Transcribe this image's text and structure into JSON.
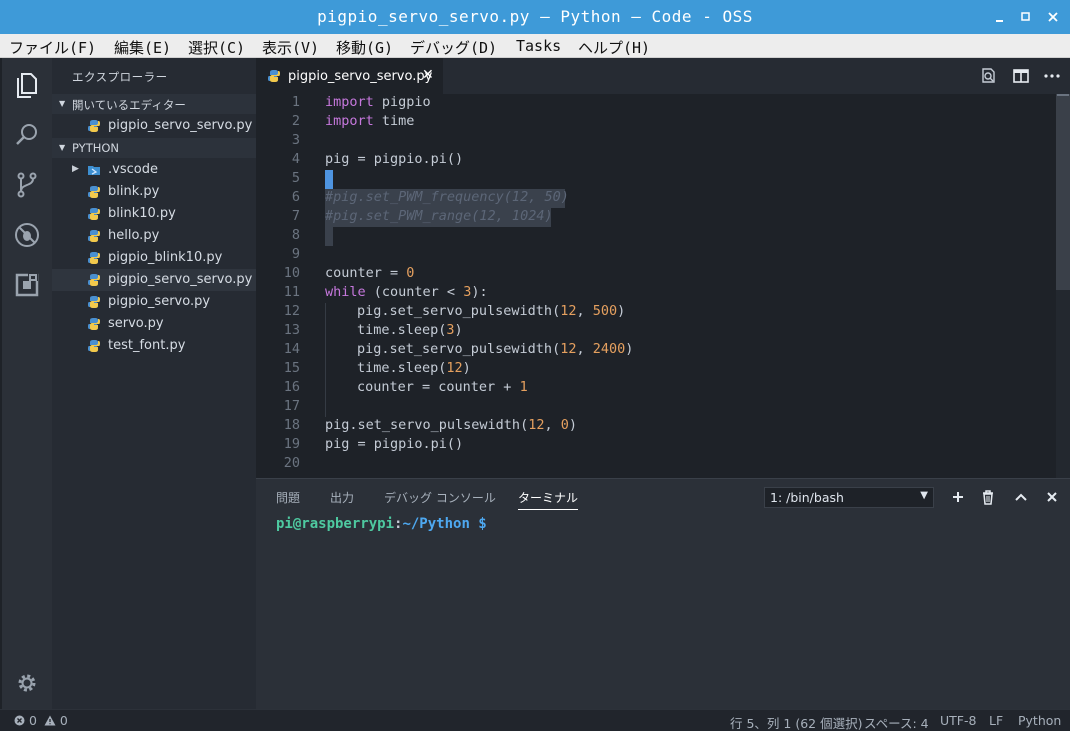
{
  "window": {
    "title": "pigpio_servo_servo.py — Python — Code - OSS"
  },
  "menu": [
    "ファイル(F)",
    "編集(E)",
    "選択(C)",
    "表示(V)",
    "移動(G)",
    "デバッグ(D)",
    "Tasks",
    "ヘルプ(H)"
  ],
  "activity_bar": {
    "icons": [
      "explorer-icon",
      "search-icon",
      "source-control-icon",
      "debug-icon",
      "extensions-icon",
      "settings-gear-icon"
    ]
  },
  "sidebar": {
    "title": "エクスプローラー",
    "open_editors_label": "開いているエディター",
    "open_editors": [
      "pigpio_servo_servo.py"
    ],
    "folder_label": "PYTHON",
    "files": [
      ".vscode",
      "blink.py",
      "blink10.py",
      "hello.py",
      "pigpio_blink10.py",
      "pigpio_servo_servo.py",
      "pigpio_servo.py",
      "servo.py",
      "test_font.py"
    ],
    "active_file": "pigpio_servo_servo.py"
  },
  "editor": {
    "tab_label": "pigpio_servo_servo.py",
    "line_numbers": [
      "1",
      "2",
      "3",
      "4",
      "5",
      "6",
      "7",
      "8",
      "9",
      "10",
      "11",
      "12",
      "13",
      "14",
      "15",
      "16",
      "17",
      "18",
      "19",
      "20"
    ],
    "line1": {
      "kw": "import",
      "rest": " pigpio"
    },
    "line2": {
      "kw": "import",
      "rest": " time"
    },
    "line4": "pig = pigpio.pi()",
    "line6": "#pig.set_PWM_frequency(12, 50)",
    "line7": "#pig.set_PWM_range(12, 1024)",
    "line10": {
      "a": "counter = ",
      "n": "0"
    },
    "line11": {
      "kw": "while",
      "a": " (counter < ",
      "n": "3",
      "b": "):"
    },
    "line12": {
      "a": "pig.set_servo_pulsewidth(",
      "n1": "12",
      "b": ", ",
      "n2": "500",
      "c": ")"
    },
    "line13": {
      "a": "time.sleep(",
      "n": "3",
      "b": ")"
    },
    "line14": {
      "a": "pig.set_servo_pulsewidth(",
      "n1": "12",
      "b": ", ",
      "n2": "2400",
      "c": ")"
    },
    "line15": {
      "a": "time.sleep(",
      "n": "12",
      "b": ")"
    },
    "line16": {
      "a": "counter = counter + ",
      "n": "1"
    },
    "line18": {
      "a": "pig.set_servo_pulsewidth(",
      "n1": "12",
      "b": ", ",
      "n2": "0",
      "c": ")"
    },
    "line19": "pig = pigpio.pi()"
  },
  "panel": {
    "tabs": [
      "問題",
      "出力",
      "デバッグ コンソール",
      "ターミナル"
    ],
    "active_tab": "ターミナル",
    "terminal_select": "1: /bin/bash",
    "prompt_user": "pi@raspberrypi",
    "prompt_sep": ":",
    "prompt_path": "~/Python $"
  },
  "statusbar": {
    "errors": "0",
    "warnings": "0",
    "position": "行 5、列 1 (62 個選択)",
    "spaces": "スペース: 4",
    "encoding": "UTF-8",
    "eol": "LF",
    "language": "Python"
  },
  "colors": {
    "titlebar": "#3e9ad8",
    "keyword": "#c678dd",
    "number": "#e5a05f",
    "prompt_user": "#4ec9a0",
    "prompt_path": "#4ea8f0"
  }
}
